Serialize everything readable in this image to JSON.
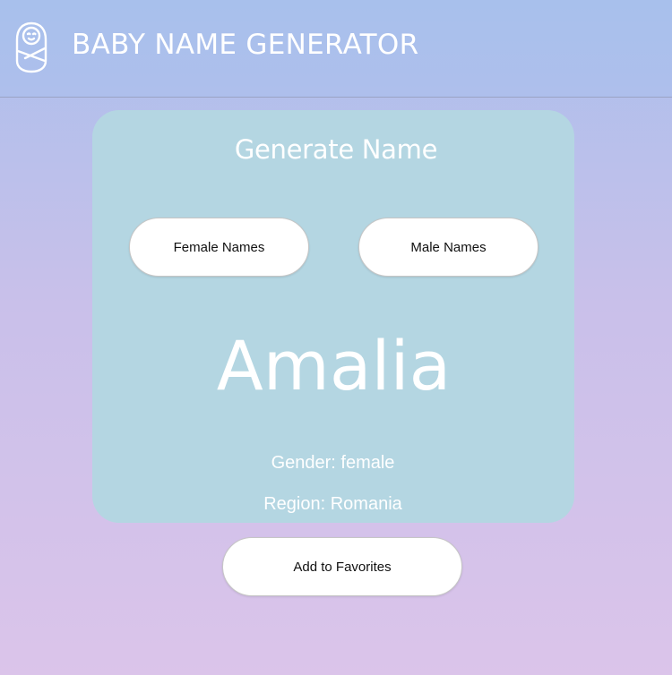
{
  "header": {
    "logo_icon": "swaddled-baby-icon",
    "title": "BABY NAME GENERATOR"
  },
  "card": {
    "title": "Generate Name",
    "female_button_label": "Female Names",
    "male_button_label": "Male Names",
    "generated_name": "Amalia",
    "gender_text": "Gender: female",
    "region_text": "Region: Romania"
  },
  "actions": {
    "add_favorites_label": "Add to Favorites"
  },
  "colors": {
    "header_bg": "#a8c0ec",
    "card_bg": "#b4d6e2",
    "gradient_top": "#aabfec",
    "gradient_bottom": "#dbc4ea",
    "text_on_color": "#ffffff"
  }
}
